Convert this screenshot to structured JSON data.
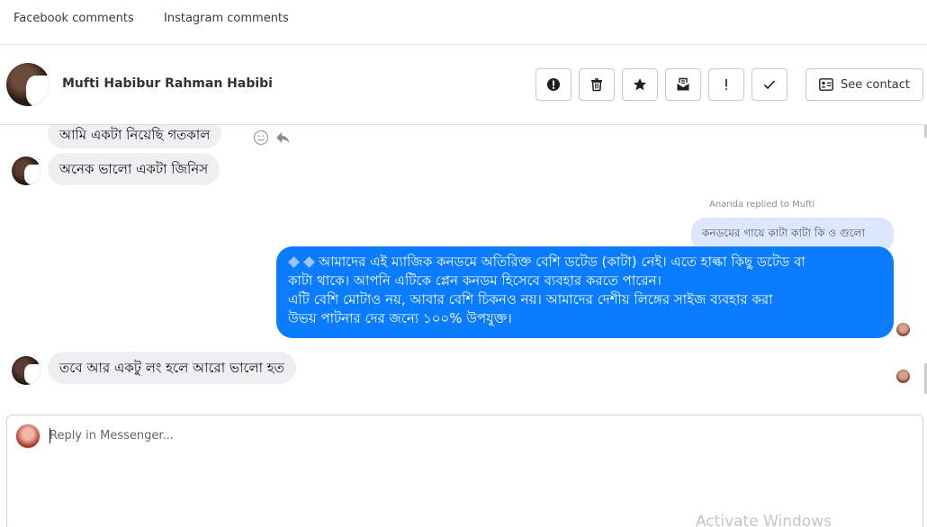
{
  "tabs": {
    "facebook": "Facebook comments",
    "instagram": "Instagram comments"
  },
  "header": {
    "contact_name": "Mufti Habibur Rahman Habibi",
    "see_contact": "See contact"
  },
  "icons": {
    "alert": "alert-circle-icon",
    "trash": "trash-icon",
    "star": "star-icon",
    "inbox": "inbox-archive-icon",
    "exclamation": "exclamation-icon",
    "check": "check-icon",
    "contact_card": "contact-card-icon",
    "emoji": "smiley-icon",
    "reply": "reply-arrow-icon"
  },
  "messages": {
    "in_1": "আমি একটা নিয়েছি গতকাল",
    "in_2": "অনেক ভালো একটা জিনিস",
    "reply_note": "Ananda replied to Mufti",
    "quoted": "কনডমের গায়ে কাটা কাটা কি ও গুলো",
    "out_lines": [
      "আমাদের এই ম্যাজিক কনডমে অতিরিক্ত  বেশি ডটেড (কাটা) নেই। এতে হাল্কা  কিছু  ডটেড বা",
      "কাটা থাকে। আপনি এটিকে প্লেন কনডম  হিসেবে ব্যবহার  করতে  পারেন।",
      "এটি বেশি মোটাও নয়, আবার  বেশি  চিকনও নয়। আমাদের  দেশীয়  লিঙ্গের সাইজ ব্যবহার  করা",
      "উভয়  পাটনার দের জন্যে  ১০০% উপযুক্ত।"
    ],
    "in_3": "তবে আর একটু লং হলে আরো ভালো হত"
  },
  "composer": {
    "placeholder": "Reply in Messenger..."
  },
  "watermark": "Activate Windows",
  "colors": {
    "outgoing": "#0a7cff",
    "incoming": "#eeeff1",
    "quoted": "#dbe7fb"
  }
}
